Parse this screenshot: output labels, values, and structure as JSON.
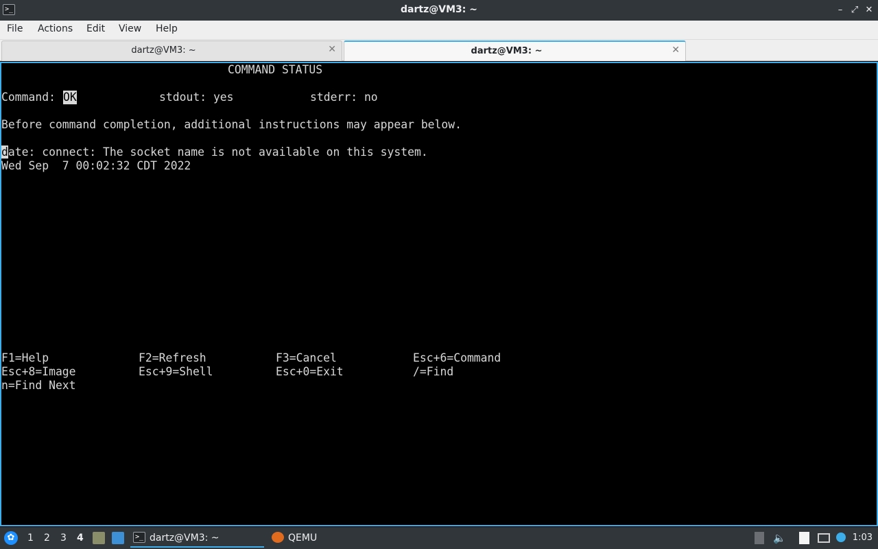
{
  "window": {
    "title": "dartz@VM3: ~",
    "icon": "terminal-icon",
    "controls": [
      "minimize-icon",
      "restore-icon",
      "close-icon"
    ]
  },
  "menu": {
    "items": [
      "File",
      "Actions",
      "Edit",
      "View",
      "Help"
    ]
  },
  "tabs": [
    {
      "label": "dartz@VM3: ~",
      "active": false
    },
    {
      "label": "dartz@VM3: ~",
      "active": true
    }
  ],
  "terminal": {
    "header": "COMMAND STATUS",
    "command_label": "Command:",
    "command_value": "OK",
    "stdout": "stdout: yes",
    "stderr": "stderr: no",
    "info": "Before command completion, additional instructions may appear below.",
    "output_cursor_char": "d",
    "output_line1_rest": "ate: connect: The socket name is not available on this system.",
    "output_line2": "Wed Sep  7 00:02:32 CDT 2022",
    "keys": {
      "row1": [
        "F1=Help",
        "F2=Refresh",
        "F3=Cancel",
        "Esc+6=Command"
      ],
      "row2": [
        "Esc+8=Image",
        "Esc+9=Shell",
        "Esc+0=Exit",
        "/=Find"
      ],
      "row3": [
        "n=Find Next"
      ]
    }
  },
  "taskbar": {
    "desktops": [
      "1",
      "2",
      "3",
      "4"
    ],
    "current_desktop": "4",
    "tasks": [
      {
        "label": "dartz@VM3: ~",
        "icon": "terminal-icon",
        "active": true
      },
      {
        "label": "QEMU",
        "icon": "qemu-icon",
        "active": false
      }
    ],
    "clock": "1:03",
    "colors": {
      "panel": "#31363b",
      "accent": "#3daee9"
    }
  }
}
